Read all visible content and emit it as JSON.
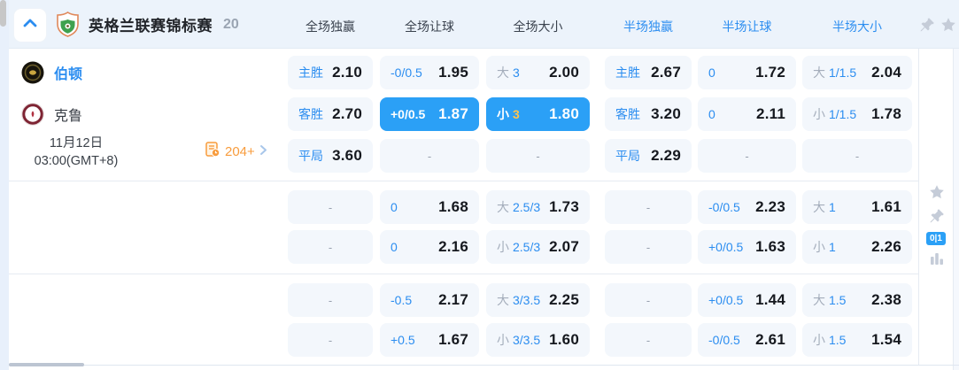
{
  "header": {
    "league_name": "英格兰联赛锦标赛",
    "match_count": "20",
    "columns": [
      {
        "label": "全场独赢"
      },
      {
        "label": "全场让球"
      },
      {
        "label": "全场大小"
      },
      {
        "label": "半场独赢"
      },
      {
        "label": "半场让球"
      },
      {
        "label": "半场大小"
      }
    ]
  },
  "match": {
    "home_team": "伯顿",
    "away_team": "克鲁",
    "date": "11月12日",
    "time": "03:00(GMT+8)",
    "more_markets_count": "204+"
  },
  "side_panel": {
    "corner_badge": "0|1"
  },
  "colors": {
    "accent_blue": "#2b8df0",
    "highlight_blue": "#2ba0f6",
    "gold": "#ffc44d",
    "orange": "#f89c3d",
    "icon_gray": "#c5ccd8",
    "header_bg": "#ecf3fb",
    "cell_bg": "#f3f7fc"
  },
  "odds_groups": [
    {
      "rows": [
        {
          "cells": [
            {
              "label": "主胜",
              "value": "2.10"
            },
            {
              "label": "-0/0.5",
              "value": "1.95"
            },
            {
              "prefix": "大",
              "line": "3",
              "value": "2.00"
            },
            {
              "label": "主胜",
              "value": "2.67"
            },
            {
              "label": "0",
              "value": "1.72"
            },
            {
              "prefix": "大",
              "line": "1/1.5",
              "value": "2.04"
            }
          ]
        },
        {
          "cells": [
            {
              "label": "客胜",
              "value": "2.70"
            },
            {
              "label": "+0/0.5",
              "value": "1.87",
              "hl": true
            },
            {
              "prefix": "小",
              "line": "3",
              "value": "1.80",
              "hl": true
            },
            {
              "label": "客胜",
              "value": "3.20"
            },
            {
              "label": "0",
              "value": "2.11"
            },
            {
              "prefix": "小",
              "line": "1/1.5",
              "value": "1.78"
            }
          ]
        },
        {
          "cells": [
            {
              "label": "平局",
              "value": "3.60"
            },
            {
              "dash": true
            },
            {
              "dash": true
            },
            {
              "label": "平局",
              "value": "2.29"
            },
            {
              "dash": true
            },
            {
              "dash": true
            }
          ]
        }
      ]
    },
    {
      "rows": [
        {
          "cells": [
            {
              "dash": true
            },
            {
              "label": "0",
              "value": "1.68"
            },
            {
              "prefix": "大",
              "line": "2.5/3",
              "value": "1.73"
            },
            {
              "dash": true
            },
            {
              "label": "-0/0.5",
              "value": "2.23"
            },
            {
              "prefix": "大",
              "line": "1",
              "value": "1.61"
            }
          ]
        },
        {
          "cells": [
            {
              "dash": true
            },
            {
              "label": "0",
              "value": "2.16"
            },
            {
              "prefix": "小",
              "line": "2.5/3",
              "value": "2.07"
            },
            {
              "dash": true
            },
            {
              "label": "+0/0.5",
              "value": "1.63"
            },
            {
              "prefix": "小",
              "line": "1",
              "value": "2.26"
            }
          ]
        }
      ]
    },
    {
      "rows": [
        {
          "cells": [
            {
              "dash": true
            },
            {
              "label": "-0.5",
              "value": "2.17"
            },
            {
              "prefix": "大",
              "line": "3/3.5",
              "value": "2.25"
            },
            {
              "dash": true
            },
            {
              "label": "+0/0.5",
              "value": "1.44"
            },
            {
              "prefix": "大",
              "line": "1.5",
              "value": "2.38"
            }
          ]
        },
        {
          "cells": [
            {
              "dash": true
            },
            {
              "label": "+0.5",
              "value": "1.67"
            },
            {
              "prefix": "小",
              "line": "3/3.5",
              "value": "1.60"
            },
            {
              "dash": true
            },
            {
              "label": "-0/0.5",
              "value": "2.61"
            },
            {
              "prefix": "小",
              "line": "1.5",
              "value": "1.54"
            }
          ]
        }
      ]
    }
  ]
}
